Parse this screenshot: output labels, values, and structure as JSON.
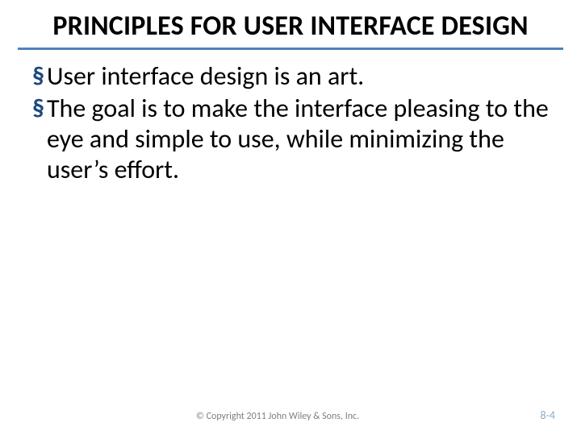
{
  "title": "PRINCIPLES FOR USER INTERFACE DESIGN",
  "bullets": [
    "User interface design is an art.",
    "The goal is to make the interface pleasing to the eye and simple to use, while minimizing the user’s effort."
  ],
  "copyright": "© Copyright 2011 John Wiley & Sons, Inc.",
  "page": "8-4",
  "colors": {
    "rule": "#4f81bd",
    "bullet_glyph": "#1f497d",
    "pagenum": "#8aa9c7"
  }
}
